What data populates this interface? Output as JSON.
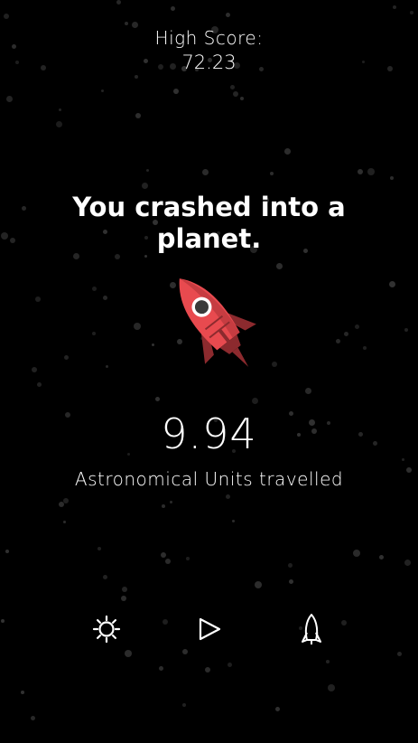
{
  "high_score": {
    "label": "High Score:",
    "value": "72.23"
  },
  "result": {
    "message": "You crashed into a planet.",
    "distance": "9.94",
    "units_label": "Astronomical Units travelled"
  },
  "colors": {
    "background": "#000000",
    "rocket_body": "#e84a4f",
    "rocket_dark": "#8c2a2e",
    "text": "#ffffff"
  },
  "controls": {
    "settings_icon": "gear-icon",
    "play_icon": "play-icon",
    "rocket_icon": "rocket-icon"
  }
}
